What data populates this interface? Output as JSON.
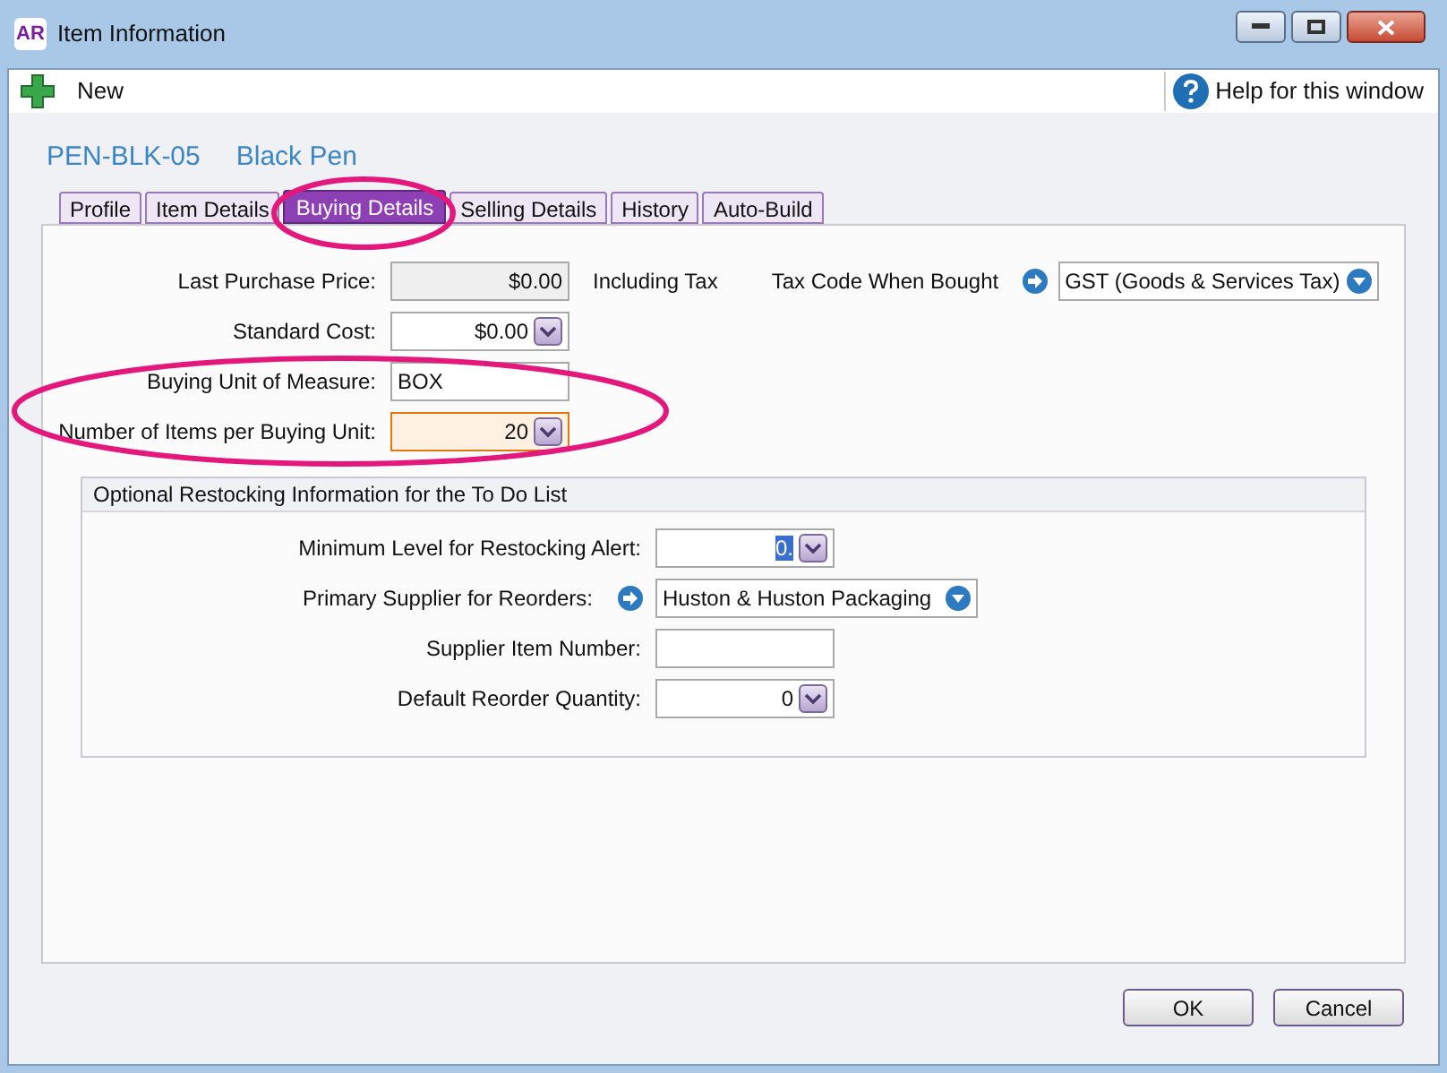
{
  "window": {
    "title": "Item Information",
    "app_badge": "AR"
  },
  "toolbar": {
    "new_label": "New",
    "help_label": "Help for this window"
  },
  "header": {
    "item_number": "PEN-BLK-05",
    "item_name": "Black Pen"
  },
  "tabs": [
    {
      "label": "Profile",
      "selected": false
    },
    {
      "label": "Item Details",
      "selected": false
    },
    {
      "label": "Buying Details",
      "selected": true
    },
    {
      "label": "Selling Details",
      "selected": false
    },
    {
      "label": "History",
      "selected": false
    },
    {
      "label": "Auto-Build",
      "selected": false
    }
  ],
  "buying_fields": [
    {
      "label": "Last Purchase Price:",
      "value": "$0.00",
      "kind": "readonly",
      "focused": false
    },
    {
      "label": "Standard Cost:",
      "value": "$0.00",
      "kind": "dropdown",
      "focused": false
    },
    {
      "label": "Buying Unit of Measure:",
      "value": "BOX",
      "kind": "text",
      "focused": false
    },
    {
      "label": "Number of Items per Buying Unit:",
      "value": "20",
      "kind": "dropdown",
      "focused": true
    }
  ],
  "including_tax": "Including Tax",
  "tax_code": {
    "label": "Tax Code When Bought",
    "value": "GST (Goods & Services Tax)"
  },
  "restocking": {
    "title": "Optional Restocking Information for the To Do List",
    "fields": [
      {
        "label": "Minimum Level for Restocking Alert:",
        "value": "0.",
        "kind": "dropdown",
        "text_selected": true
      },
      {
        "label": "Primary Supplier for Reorders:",
        "value": "Huston & Huston Packaging",
        "kind": "lookup"
      },
      {
        "label": "Supplier Item Number:",
        "kind": "text"
      },
      {
        "label": "Default Reorder Quantity:",
        "value": "0",
        "kind": "dropdown"
      }
    ]
  },
  "buttons": [
    {
      "label": "OK"
    },
    {
      "label": "Cancel"
    }
  ]
}
